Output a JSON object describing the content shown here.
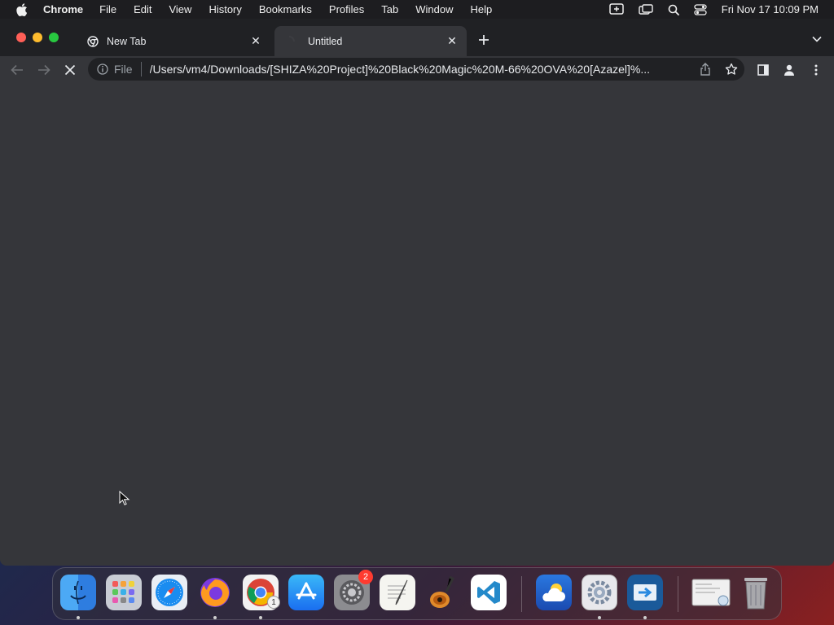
{
  "menubar": {
    "app_name": "Chrome",
    "items": [
      "File",
      "Edit",
      "View",
      "History",
      "Bookmarks",
      "Profiles",
      "Tab",
      "Window",
      "Help"
    ],
    "clock": "Fri Nov 17  10:09 PM"
  },
  "tabs": [
    {
      "title": "New Tab",
      "active": false
    },
    {
      "title": "Untitled",
      "active": true
    }
  ],
  "toolbar": {
    "scheme_label": "File",
    "url": "/Users/vm4/Downloads/[SHIZA%20Project]%20Black%20Magic%20M-66%20OVA%20[Azazel]%..."
  },
  "dock": {
    "apps": [
      {
        "name": "Finder",
        "icon": "finder-icon"
      },
      {
        "name": "Launchpad",
        "icon": "launchpad-icon"
      },
      {
        "name": "Safari",
        "icon": "safari-icon"
      },
      {
        "name": "Firefox",
        "icon": "firefox-icon"
      },
      {
        "name": "Chrome",
        "icon": "chrome-icon",
        "badge": "1"
      },
      {
        "name": "App Store",
        "icon": "appstore-icon"
      },
      {
        "name": "System Preferences",
        "icon": "system-preferences-icon",
        "badge": "2"
      },
      {
        "name": "TextEdit",
        "icon": "textedit-icon"
      },
      {
        "name": "GarageBand",
        "icon": "garageband-icon"
      },
      {
        "name": "Visual Studio Code",
        "icon": "vscode-icon"
      },
      {
        "name": "Weather",
        "icon": "weather-icon"
      },
      {
        "name": "Settings",
        "icon": "settings-icon"
      },
      {
        "name": "Migration Assistant",
        "icon": "migration-icon"
      },
      {
        "name": "Preview",
        "icon": "preview-icon"
      },
      {
        "name": "Trash",
        "icon": "trash-icon"
      }
    ]
  },
  "colors": {
    "window_bg": "#35363a",
    "tabstrip_bg": "#202124",
    "omnibox_bg": "#202124",
    "close": "#ff5f57",
    "minimize": "#febc2e",
    "maximize": "#28c840",
    "badge": "#ff3b30"
  }
}
